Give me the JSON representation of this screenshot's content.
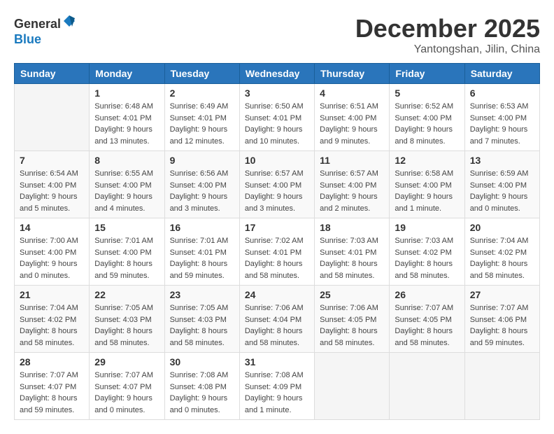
{
  "logo": {
    "general": "General",
    "blue": "Blue"
  },
  "header": {
    "month": "December 2025",
    "location": "Yantongshan, Jilin, China"
  },
  "weekdays": [
    "Sunday",
    "Monday",
    "Tuesday",
    "Wednesday",
    "Thursday",
    "Friday",
    "Saturday"
  ],
  "weeks": [
    [
      {
        "day": "",
        "sunrise": "",
        "sunset": "",
        "daylight": ""
      },
      {
        "day": "1",
        "sunrise": "Sunrise: 6:48 AM",
        "sunset": "Sunset: 4:01 PM",
        "daylight": "Daylight: 9 hours and 13 minutes."
      },
      {
        "day": "2",
        "sunrise": "Sunrise: 6:49 AM",
        "sunset": "Sunset: 4:01 PM",
        "daylight": "Daylight: 9 hours and 12 minutes."
      },
      {
        "day": "3",
        "sunrise": "Sunrise: 6:50 AM",
        "sunset": "Sunset: 4:01 PM",
        "daylight": "Daylight: 9 hours and 10 minutes."
      },
      {
        "day": "4",
        "sunrise": "Sunrise: 6:51 AM",
        "sunset": "Sunset: 4:00 PM",
        "daylight": "Daylight: 9 hours and 9 minutes."
      },
      {
        "day": "5",
        "sunrise": "Sunrise: 6:52 AM",
        "sunset": "Sunset: 4:00 PM",
        "daylight": "Daylight: 9 hours and 8 minutes."
      },
      {
        "day": "6",
        "sunrise": "Sunrise: 6:53 AM",
        "sunset": "Sunset: 4:00 PM",
        "daylight": "Daylight: 9 hours and 7 minutes."
      }
    ],
    [
      {
        "day": "7",
        "sunrise": "Sunrise: 6:54 AM",
        "sunset": "Sunset: 4:00 PM",
        "daylight": "Daylight: 9 hours and 5 minutes."
      },
      {
        "day": "8",
        "sunrise": "Sunrise: 6:55 AM",
        "sunset": "Sunset: 4:00 PM",
        "daylight": "Daylight: 9 hours and 4 minutes."
      },
      {
        "day": "9",
        "sunrise": "Sunrise: 6:56 AM",
        "sunset": "Sunset: 4:00 PM",
        "daylight": "Daylight: 9 hours and 3 minutes."
      },
      {
        "day": "10",
        "sunrise": "Sunrise: 6:57 AM",
        "sunset": "Sunset: 4:00 PM",
        "daylight": "Daylight: 9 hours and 3 minutes."
      },
      {
        "day": "11",
        "sunrise": "Sunrise: 6:57 AM",
        "sunset": "Sunset: 4:00 PM",
        "daylight": "Daylight: 9 hours and 2 minutes."
      },
      {
        "day": "12",
        "sunrise": "Sunrise: 6:58 AM",
        "sunset": "Sunset: 4:00 PM",
        "daylight": "Daylight: 9 hours and 1 minute."
      },
      {
        "day": "13",
        "sunrise": "Sunrise: 6:59 AM",
        "sunset": "Sunset: 4:00 PM",
        "daylight": "Daylight: 9 hours and 0 minutes."
      }
    ],
    [
      {
        "day": "14",
        "sunrise": "Sunrise: 7:00 AM",
        "sunset": "Sunset: 4:00 PM",
        "daylight": "Daylight: 9 hours and 0 minutes."
      },
      {
        "day": "15",
        "sunrise": "Sunrise: 7:01 AM",
        "sunset": "Sunset: 4:00 PM",
        "daylight": "Daylight: 8 hours and 59 minutes."
      },
      {
        "day": "16",
        "sunrise": "Sunrise: 7:01 AM",
        "sunset": "Sunset: 4:01 PM",
        "daylight": "Daylight: 8 hours and 59 minutes."
      },
      {
        "day": "17",
        "sunrise": "Sunrise: 7:02 AM",
        "sunset": "Sunset: 4:01 PM",
        "daylight": "Daylight: 8 hours and 58 minutes."
      },
      {
        "day": "18",
        "sunrise": "Sunrise: 7:03 AM",
        "sunset": "Sunset: 4:01 PM",
        "daylight": "Daylight: 8 hours and 58 minutes."
      },
      {
        "day": "19",
        "sunrise": "Sunrise: 7:03 AM",
        "sunset": "Sunset: 4:02 PM",
        "daylight": "Daylight: 8 hours and 58 minutes."
      },
      {
        "day": "20",
        "sunrise": "Sunrise: 7:04 AM",
        "sunset": "Sunset: 4:02 PM",
        "daylight": "Daylight: 8 hours and 58 minutes."
      }
    ],
    [
      {
        "day": "21",
        "sunrise": "Sunrise: 7:04 AM",
        "sunset": "Sunset: 4:02 PM",
        "daylight": "Daylight: 8 hours and 58 minutes."
      },
      {
        "day": "22",
        "sunrise": "Sunrise: 7:05 AM",
        "sunset": "Sunset: 4:03 PM",
        "daylight": "Daylight: 8 hours and 58 minutes."
      },
      {
        "day": "23",
        "sunrise": "Sunrise: 7:05 AM",
        "sunset": "Sunset: 4:03 PM",
        "daylight": "Daylight: 8 hours and 58 minutes."
      },
      {
        "day": "24",
        "sunrise": "Sunrise: 7:06 AM",
        "sunset": "Sunset: 4:04 PM",
        "daylight": "Daylight: 8 hours and 58 minutes."
      },
      {
        "day": "25",
        "sunrise": "Sunrise: 7:06 AM",
        "sunset": "Sunset: 4:05 PM",
        "daylight": "Daylight: 8 hours and 58 minutes."
      },
      {
        "day": "26",
        "sunrise": "Sunrise: 7:07 AM",
        "sunset": "Sunset: 4:05 PM",
        "daylight": "Daylight: 8 hours and 58 minutes."
      },
      {
        "day": "27",
        "sunrise": "Sunrise: 7:07 AM",
        "sunset": "Sunset: 4:06 PM",
        "daylight": "Daylight: 8 hours and 59 minutes."
      }
    ],
    [
      {
        "day": "28",
        "sunrise": "Sunrise: 7:07 AM",
        "sunset": "Sunset: 4:07 PM",
        "daylight": "Daylight: 8 hours and 59 minutes."
      },
      {
        "day": "29",
        "sunrise": "Sunrise: 7:07 AM",
        "sunset": "Sunset: 4:07 PM",
        "daylight": "Daylight: 9 hours and 0 minutes."
      },
      {
        "day": "30",
        "sunrise": "Sunrise: 7:08 AM",
        "sunset": "Sunset: 4:08 PM",
        "daylight": "Daylight: 9 hours and 0 minutes."
      },
      {
        "day": "31",
        "sunrise": "Sunrise: 7:08 AM",
        "sunset": "Sunset: 4:09 PM",
        "daylight": "Daylight: 9 hours and 1 minute."
      },
      {
        "day": "",
        "sunrise": "",
        "sunset": "",
        "daylight": ""
      },
      {
        "day": "",
        "sunrise": "",
        "sunset": "",
        "daylight": ""
      },
      {
        "day": "",
        "sunrise": "",
        "sunset": "",
        "daylight": ""
      }
    ]
  ]
}
